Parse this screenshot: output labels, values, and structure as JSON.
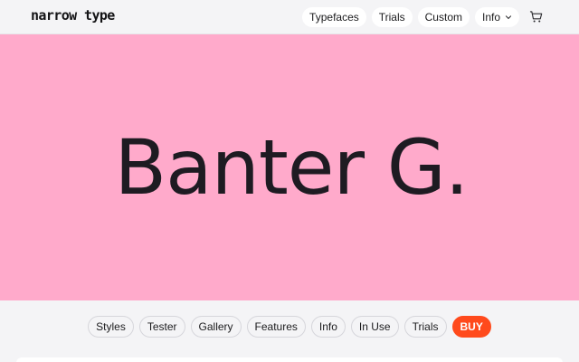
{
  "header": {
    "logo": "narrow type",
    "nav": [
      {
        "label": "Typefaces"
      },
      {
        "label": "Trials"
      },
      {
        "label": "Custom"
      },
      {
        "label": "Info"
      }
    ],
    "cart_icon": "cart-icon"
  },
  "hero": {
    "title": "Banter G.",
    "background": "#ffaacb"
  },
  "subnav": {
    "items": [
      {
        "label": "Styles"
      },
      {
        "label": "Tester"
      },
      {
        "label": "Gallery"
      },
      {
        "label": "Features"
      },
      {
        "label": "Info"
      },
      {
        "label": "In Use"
      },
      {
        "label": "Trials"
      },
      {
        "label": "BUY"
      }
    ],
    "buy_color": "#ff4a1c"
  }
}
